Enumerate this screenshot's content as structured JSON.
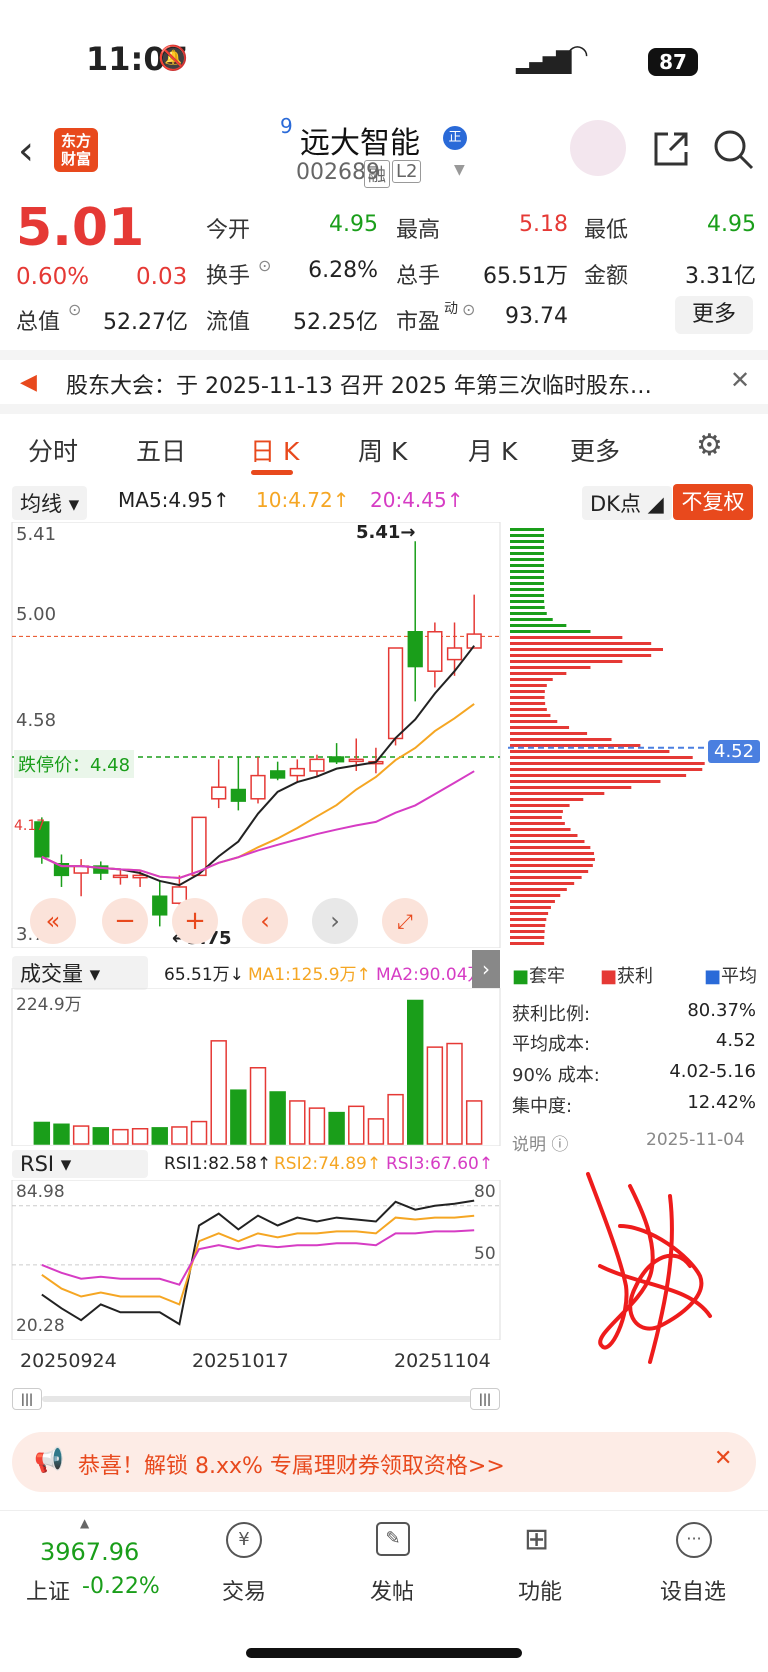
{
  "status": {
    "time": "11:07",
    "battery": "87"
  },
  "header": {
    "logo_line1": "东方",
    "logo_line2": "财富",
    "superscript": "9",
    "name": "远大智能",
    "badge": "正",
    "code": "002689",
    "tag1": "融",
    "tag2": "L2"
  },
  "quote": {
    "price": "5.01",
    "change_pct": "0.60%",
    "change": "0.03",
    "open_label": "今开",
    "open": "4.95",
    "high_label": "最高",
    "high": "5.18",
    "low_label": "最低",
    "low": "4.95",
    "turnover_label": "换手",
    "turnover": "6.28%",
    "volume_label": "总手",
    "volume": "65.51万",
    "amount_label": "金额",
    "amount": "3.31亿",
    "mktcap_label": "总值",
    "mktcap": "52.27亿",
    "float_label": "流值",
    "float": "52.25亿",
    "pe_label": "市盈",
    "pe_sup": "动",
    "pe": "93.74",
    "more": "更多"
  },
  "notice": {
    "text": "股东大会：于 2025-11-13 召开 2025 年第三次临时股东…"
  },
  "tabs": [
    "分时",
    "五日",
    "日 K",
    "周 K",
    "月 K",
    "更多"
  ],
  "indicators": {
    "ma_select": "均线",
    "ma5": "MA5:4.95↑",
    "ma10": "10:4.72↑",
    "ma20": "20:4.45↑",
    "dk": "DK点",
    "fq": "不复权",
    "vol_select": "成交量",
    "vol": "65.51万↓",
    "vma1": "MA1:125.9万↑",
    "vma2": "MA2:90.04万↑",
    "rsi_select": "RSI",
    "rsi1": "RSI1:82.58↑",
    "rsi2": "RSI2:74.89↑",
    "rsi3": "RSI3:67.60↑"
  },
  "kchart": {
    "y_top": "5.41",
    "y_mid1": "5.00",
    "y_mid2": "4.58",
    "y_bot": "3.75",
    "y_left_small": "4.17",
    "limit_label": "跌停价：4.48",
    "high_mark": "5.41→",
    "low_mark": "←3.75",
    "chip_price": "4.52"
  },
  "chart_data": {
    "type": "candlestick",
    "candles": [
      {
        "o": 4.2,
        "c": 4.05,
        "h": 4.22,
        "l": 4.02
      },
      {
        "o": 4.02,
        "c": 3.97,
        "h": 4.06,
        "l": 3.92
      },
      {
        "o": 3.98,
        "c": 4.01,
        "h": 4.04,
        "l": 3.88
      },
      {
        "o": 4.01,
        "c": 3.98,
        "h": 4.03,
        "l": 3.95
      },
      {
        "o": 3.97,
        "c": 3.97,
        "h": 4.0,
        "l": 3.93
      },
      {
        "o": 3.96,
        "c": 3.97,
        "h": 3.99,
        "l": 3.92
      },
      {
        "o": 3.88,
        "c": 3.8,
        "h": 3.95,
        "l": 3.75
      },
      {
        "o": 3.85,
        "c": 3.92,
        "h": 3.97,
        "l": 3.8
      },
      {
        "o": 3.97,
        "c": 4.22,
        "h": 4.22,
        "l": 3.97
      },
      {
        "o": 4.3,
        "c": 4.35,
        "h": 4.47,
        "l": 4.26
      },
      {
        "o": 4.34,
        "c": 4.29,
        "h": 4.48,
        "l": 4.25
      },
      {
        "o": 4.3,
        "c": 4.4,
        "h": 4.48,
        "l": 4.28
      },
      {
        "o": 4.42,
        "c": 4.39,
        "h": 4.46,
        "l": 4.38
      },
      {
        "o": 4.4,
        "c": 4.43,
        "h": 4.47,
        "l": 4.37
      },
      {
        "o": 4.42,
        "c": 4.47,
        "h": 4.49,
        "l": 4.4
      },
      {
        "o": 4.48,
        "c": 4.46,
        "h": 4.54,
        "l": 4.45
      },
      {
        "o": 4.47,
        "c": 4.47,
        "h": 4.56,
        "l": 4.42
      },
      {
        "o": 4.46,
        "c": 4.46,
        "h": 4.52,
        "l": 4.41
      },
      {
        "o": 4.56,
        "c": 4.95,
        "h": 4.95,
        "l": 4.53
      },
      {
        "o": 5.02,
        "c": 4.87,
        "h": 5.41,
        "l": 4.72
      },
      {
        "o": 4.85,
        "c": 5.02,
        "h": 5.06,
        "l": 4.78
      },
      {
        "o": 4.9,
        "c": 4.95,
        "h": 5.06,
        "l": 4.83
      },
      {
        "o": 4.95,
        "c": 5.01,
        "h": 5.18,
        "l": 4.95
      }
    ],
    "volume": [
      24,
      22,
      20,
      18,
      16,
      17,
      18,
      19,
      25,
      115,
      60,
      85,
      58,
      48,
      40,
      35,
      42,
      28,
      55,
      160,
      108,
      112,
      48
    ],
    "vol_ylabel": "224.9万",
    "rsi_ticks": [
      "84.98",
      "80",
      "50",
      "20.28"
    ],
    "x_labels": [
      "20250924",
      "20251017",
      "20251104"
    ],
    "chips": {
      "legend": [
        "套牢",
        "获利",
        "平均"
      ],
      "rows": [
        {
          "label": "获利比例:",
          "value": "80.37%"
        },
        {
          "label": "平均成本:",
          "value": "4.52"
        },
        {
          "label": "90% 成本:",
          "value": "4.02-5.16"
        },
        {
          "label": "集中度:",
          "value": "12.42%"
        }
      ],
      "note": "说明",
      "date": "2025-11-04"
    }
  },
  "promo": {
    "text": "恭喜！解锁 8.xx% 专属理财券领取资格>>"
  },
  "bottom_nav": {
    "index_value": "3967.96",
    "index_label": "上证",
    "index_change": "-0.22%",
    "items": [
      "交易",
      "发帖",
      "功能",
      "设自选"
    ]
  }
}
